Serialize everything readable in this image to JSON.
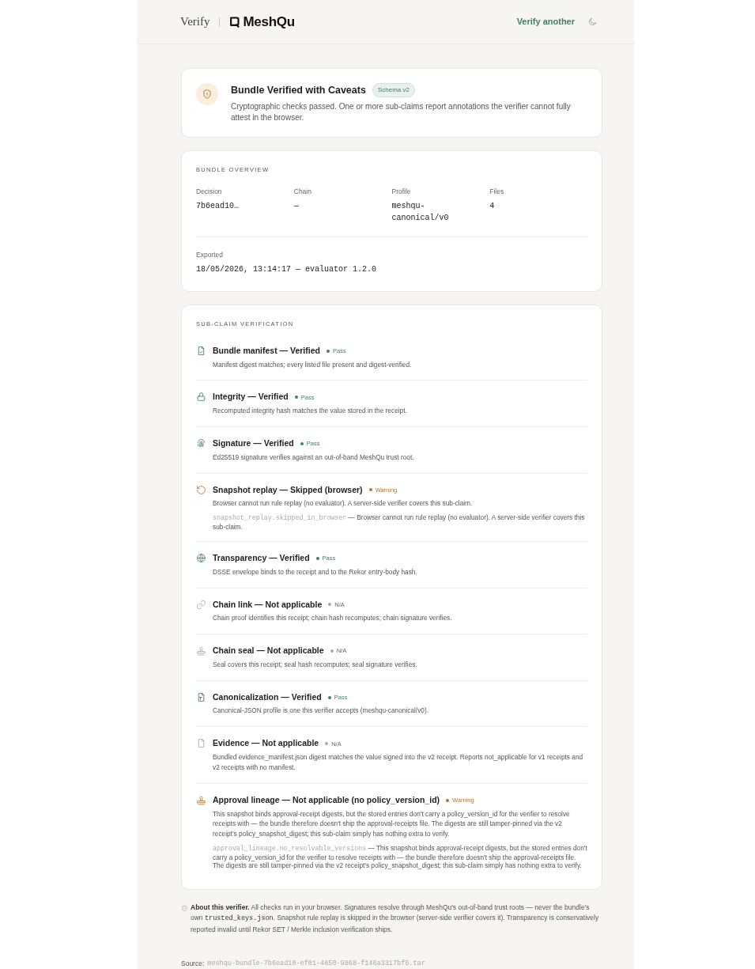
{
  "header": {
    "title": "Verify",
    "brand": "MeshQu",
    "action": "Verify another"
  },
  "summary": {
    "title": "Bundle Verified with Caveats",
    "badge": "Schema v2",
    "description": "Cryptographic checks passed. One or more sub-claims report annotations the verifier cannot fully attest in the browser."
  },
  "overview": {
    "heading": "BUNDLE OVERVIEW",
    "fields": [
      {
        "label": "Decision",
        "value": "7b6ead10…"
      },
      {
        "label": "Chain",
        "value": "—"
      },
      {
        "label": "Profile",
        "value": "meshqu-canonical/v0"
      },
      {
        "label": "Files",
        "value": "4"
      }
    ],
    "exported": {
      "label": "Exported",
      "value": "18/05/2026, 13:14:17 — evaluator 1.2.0"
    }
  },
  "subclaims": {
    "heading": "SUB-CLAIM VERIFICATION",
    "items": [
      {
        "kind": "file-check",
        "title": "Bundle manifest — Verified",
        "color": "#3d8266",
        "status_label": "Pass",
        "description": "Manifest digest matches; every listed file present and digest-verified."
      },
      {
        "kind": "lock",
        "title": "Integrity — Verified",
        "color": "#3d8266",
        "status_label": "Pass",
        "description": "Recomputed integrity hash matches the value stored in the receipt."
      },
      {
        "kind": "fingerprint",
        "title": "Signature — Verified",
        "color": "#3d8266",
        "status_label": "Pass",
        "description": "Ed25519 signature verifies against an out-of-band MeshQu trust root."
      },
      {
        "kind": "rotate",
        "title": "Snapshot replay — Skipped (browser)",
        "color": "#b8732e",
        "status_label": "Warning",
        "description": "Browser cannot run rule replay (no evaluator). A server-side verifier covers this sub-claim.",
        "detail": {
          "code": "snapshot_replay.skipped_in_browser",
          "text": " — Browser cannot run rule replay (no evaluator). A server-side verifier covers this sub-claim."
        }
      },
      {
        "kind": "globe",
        "title": "Transparency — Verified",
        "color": "#3d8266",
        "status_label": "Pass",
        "description": "DSSE envelope binds to the receipt and to the Rekor entry-body hash."
      },
      {
        "kind": "link",
        "title": "Chain link — Not applicable",
        "color": "#a8a8a8",
        "status_label": "N/A",
        "description": "Chain proof identifies this receipt; chain hash recomputes; chain signature verifies."
      },
      {
        "kind": "stamp",
        "title": "Chain seal — Not applicable",
        "color": "#a8a8a8",
        "status_label": "N/A",
        "description": "Seal covers this receipt; seal hash recomputes; seal signature verifies."
      },
      {
        "kind": "file-code",
        "title": "Canonicalization — Verified",
        "color": "#3d8266",
        "status_label": "Pass",
        "description": "Canonical-JSON profile is one this verifier accepts (meshqu-canonical/v0)."
      },
      {
        "kind": "file",
        "title": "Evidence — Not applicable",
        "color": "#a8a8a8",
        "status_label": "N/A",
        "description": "Bundled evidence_manifest.json digest matches the value signed into the v2 receipt. Reports not_applicable for v1 receipts and v2 receipts with no manifest."
      },
      {
        "kind": "stamp",
        "title": "Approval lineage — Not applicable (no policy_version_id)",
        "color": "#b8732e",
        "status_label": "Warning",
        "description": "This snapshot binds approval-receipt digests, but the stored entries don't carry a policy_version_id for the verifier to resolve receipts with — the bundle therefore doesn't ship the approval-receipts file. The digests are still tamper-pinned via the v2 receipt's policy_snapshot_digest; this sub-claim simply has nothing extra to verify.",
        "detail": {
          "code": "approval_lineage.no_resolvable_versions",
          "text": " — This snapshot binds approval-receipt digests, but the stored entries don't carry a policy_version_id for the verifier to resolve receipts with — the bundle therefore doesn't ship the approval-receipts file. The digests are still tamper-pinned via the v2 receipt's policy_snapshot_digest; this sub-claim simply has nothing extra to verify."
        }
      }
    ]
  },
  "about": [
    {
      "kind": "bold",
      "text": "About this verifier."
    },
    {
      "kind": "plain",
      "text": " All checks run in your browser. Signatures resolve through MeshQu's out-of-band trust roots — never the bundle's own "
    },
    {
      "kind": "code",
      "text": "trusted_keys.json"
    },
    {
      "kind": "plain",
      "text": ". Snapshot rule replay is skipped in the browser (server-side verifier covers it). Transparency is conservatively reported invalid until Rekor SET / Merkle inclusion verification ships."
    }
  ],
  "source": {
    "label": "Source:",
    "value": "meshqu-bundle-7b6ead10-ef01-4650-9868-f146a3317bf6.tar"
  }
}
